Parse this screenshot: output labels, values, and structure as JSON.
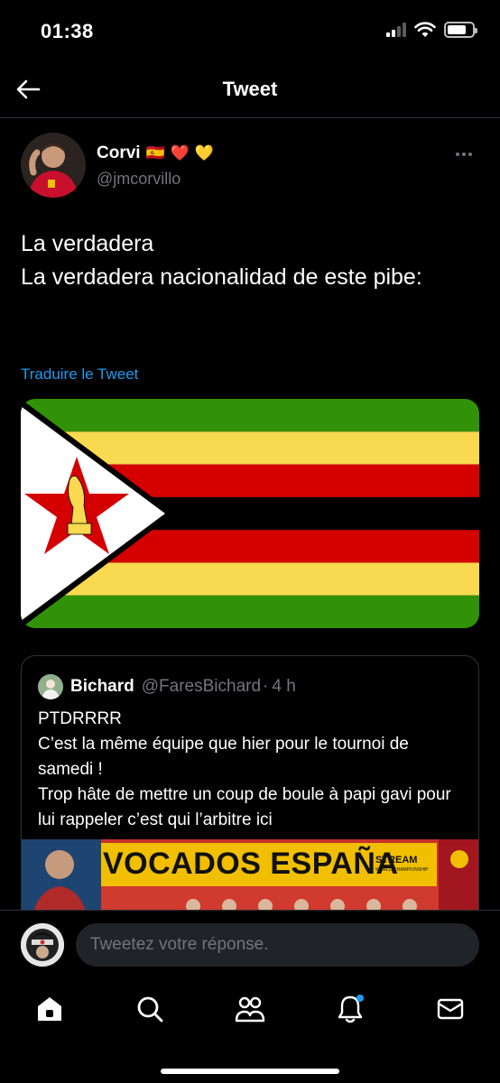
{
  "status_bar": {
    "time": "01:38"
  },
  "header": {
    "title": "Tweet",
    "back_icon": "arrow-left-icon"
  },
  "tweet": {
    "author": {
      "name": "Corvi",
      "handle": "@jmcorvillo",
      "emojis": [
        "🇪🇸",
        "❤️",
        "💛"
      ]
    },
    "text": "La verdadera\nLa verdadera nacionalidad de este pibe:",
    "translate_label": "Traduire le Tweet",
    "media_description": "flag-image"
  },
  "quoted_tweet": {
    "name": "Bichard",
    "handle": "@FaresBichard",
    "separator": "·",
    "time": "4 h",
    "text": "PTDRRRR\nC’est la même équipe que hier pour le tournoi de samedi !\nTrop hâte de mettre un coup de boule à papi gavi pour lui rappeler c’est qui l’arbitre ici",
    "media": {
      "banner_text": "VOCADOS ESPAÑA",
      "stream_label": "STREAM",
      "stream_sub": "WORLD CHAMPIONSHIP"
    }
  },
  "reply": {
    "placeholder": "Tweetez votre réponse."
  },
  "tab_bar": {
    "items": [
      "home-icon",
      "search-icon",
      "communities-icon",
      "notifications-icon",
      "messages-icon"
    ]
  },
  "colors": {
    "background": "#000000",
    "accent": "#1d9bf0",
    "secondary_text": "#71767b",
    "border": "#2f3336"
  }
}
